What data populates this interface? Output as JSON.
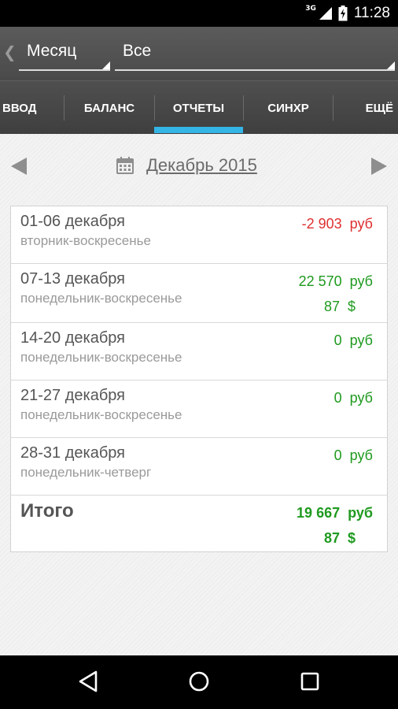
{
  "status_bar": {
    "network": "3G",
    "time": "11:28"
  },
  "action_bar": {
    "back_glyph": "❮",
    "period_spinner": "Месяц",
    "filter_spinner": "Все"
  },
  "tabs": [
    {
      "label": "ВВОД"
    },
    {
      "label": "БАЛАНС"
    },
    {
      "label": "ОТЧЕТЫ",
      "selected": true
    },
    {
      "label": "СИНХР"
    },
    {
      "label": "ЕЩЁ"
    }
  ],
  "month_nav": {
    "title": "Декабрь 2015",
    "icon": "calendar-icon"
  },
  "weeks": [
    {
      "title": "01-06 декабря",
      "subtitle": "вторник-воскресенье",
      "amounts": [
        {
          "text": "-2 903  руб",
          "color": "red"
        }
      ]
    },
    {
      "title": "07-13 декабря",
      "subtitle": "понедельник-воскресенье",
      "amounts": [
        {
          "text": "22 570  руб",
          "color": "green"
        },
        {
          "text": "87  $",
          "color": "green"
        }
      ]
    },
    {
      "title": "14-20 декабря",
      "subtitle": "понедельник-воскресенье",
      "amounts": [
        {
          "text": "0  руб",
          "color": "green"
        }
      ]
    },
    {
      "title": "21-27 декабря",
      "subtitle": "понедельник-воскресенье",
      "amounts": [
        {
          "text": "0  руб",
          "color": "green"
        }
      ]
    },
    {
      "title": "28-31 декабря",
      "subtitle": "понедельник-четверг",
      "amounts": [
        {
          "text": "0  руб",
          "color": "green"
        }
      ]
    }
  ],
  "total": {
    "title": "Итого",
    "amounts": [
      {
        "text": "19 667  руб",
        "color": "green"
      },
      {
        "text": "87  $",
        "color": "green"
      }
    ]
  },
  "colors": {
    "accent": "#33b5e5",
    "negative": "#e03030",
    "positive": "#1f9a1f"
  },
  "nav_bar": {
    "icons": [
      "back-icon",
      "home-icon",
      "recents-icon"
    ]
  }
}
